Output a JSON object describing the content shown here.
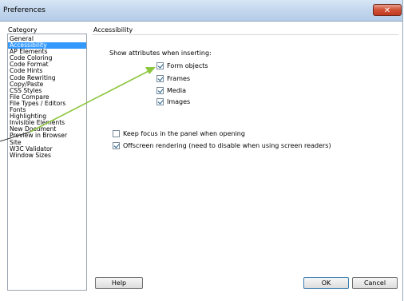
{
  "window": {
    "title": "Preferences",
    "close_glyph": "✕"
  },
  "category_label": "Category",
  "categories": [
    {
      "label": "General",
      "selected": false
    },
    {
      "label": "Accessibility",
      "selected": true
    },
    {
      "label": "AP Elements",
      "selected": false
    },
    {
      "label": "Code Coloring",
      "selected": false
    },
    {
      "label": "Code Format",
      "selected": false
    },
    {
      "label": "Code Hints",
      "selected": false
    },
    {
      "label": "Code Rewriting",
      "selected": false
    },
    {
      "label": "Copy/Paste",
      "selected": false
    },
    {
      "label": "CSS Styles",
      "selected": false
    },
    {
      "label": "File Compare",
      "selected": false
    },
    {
      "label": "File Types / Editors",
      "selected": false
    },
    {
      "label": "Fonts",
      "selected": false
    },
    {
      "label": "Highlighting",
      "selected": false
    },
    {
      "label": "Invisible Elements",
      "selected": false
    },
    {
      "label": "New Document",
      "selected": false
    },
    {
      "label": "Preview in Browser",
      "selected": false
    },
    {
      "label": "Site",
      "selected": false
    },
    {
      "label": "W3C Validator",
      "selected": false
    },
    {
      "label": "Window Sizes",
      "selected": false
    }
  ],
  "panel": {
    "title": "Accessibility",
    "show_attributes_label": "Show attributes when inserting:",
    "attributes": [
      {
        "label": "Form objects",
        "checked": true
      },
      {
        "label": "Frames",
        "checked": true
      },
      {
        "label": "Media",
        "checked": true
      },
      {
        "label": "Images",
        "checked": true
      }
    ],
    "keep_focus": {
      "label": "Keep focus in the panel when opening",
      "checked": false
    },
    "offscreen": {
      "label": "Offscreen rendering (need to disable when using screen readers)",
      "checked": true
    }
  },
  "buttons": {
    "help": "Help",
    "ok": "OK",
    "cancel": "Cancel"
  },
  "annotation": {
    "arrow_color": "#8dc63f",
    "line_color": "#333333"
  }
}
